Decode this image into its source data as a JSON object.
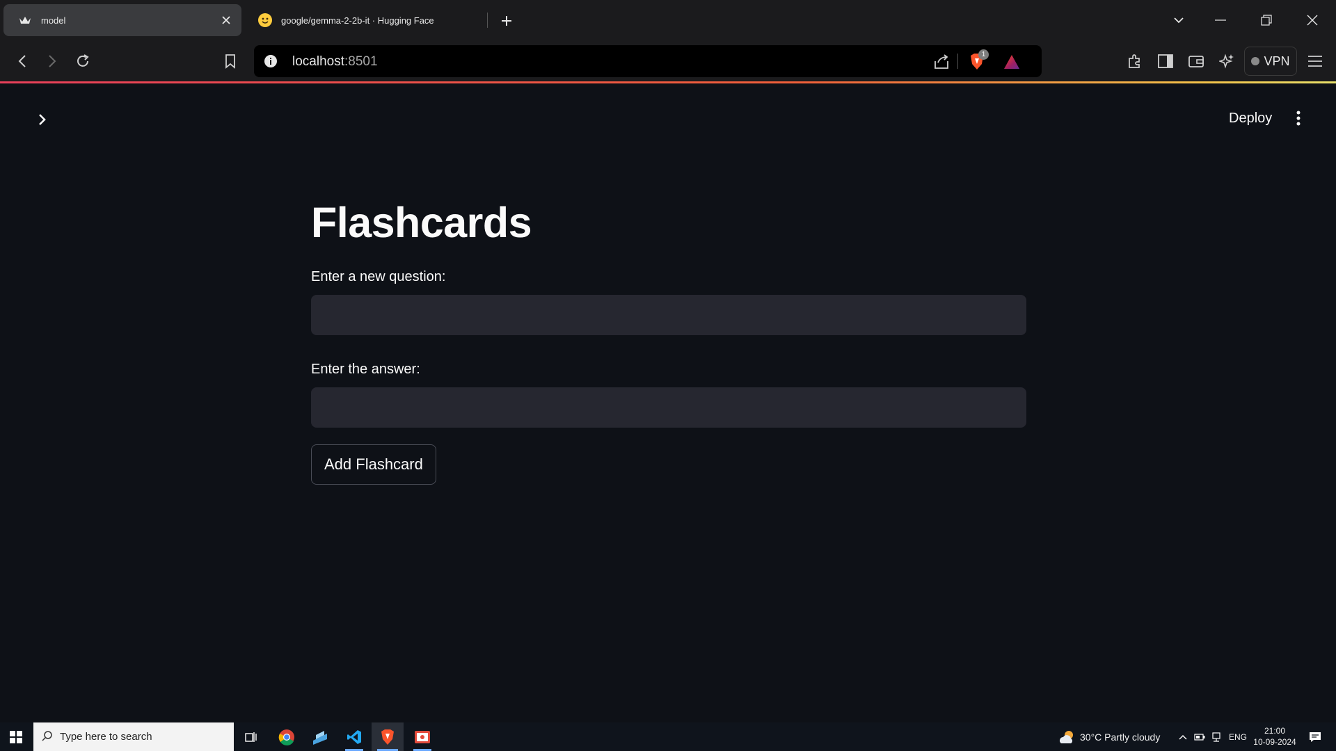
{
  "browser": {
    "tabs": [
      {
        "title": "model",
        "active": true
      },
      {
        "title": "google/gemma-2-2b-it · Hugging Face",
        "active": false
      }
    ],
    "address": {
      "host": "localhost",
      "port": ":8501"
    },
    "brave_shield_badge": "1",
    "vpn_label": "VPN"
  },
  "app": {
    "header": {
      "deploy_label": "Deploy"
    },
    "title": "Flashcards",
    "question_label": "Enter a new question:",
    "question_value": "",
    "answer_label": "Enter the answer:",
    "answer_value": "",
    "add_button_label": "Add Flashcard"
  },
  "taskbar": {
    "search_placeholder": "Type here to search",
    "weather": "30°C  Partly cloudy",
    "language": "ENG",
    "time": "21:00",
    "date": "10-09-2024"
  },
  "colors": {
    "app_bg": "#0e1117",
    "input_bg": "#262730",
    "chrome_bg": "#1b1b1d",
    "active_tab": "#3a3b3e"
  }
}
